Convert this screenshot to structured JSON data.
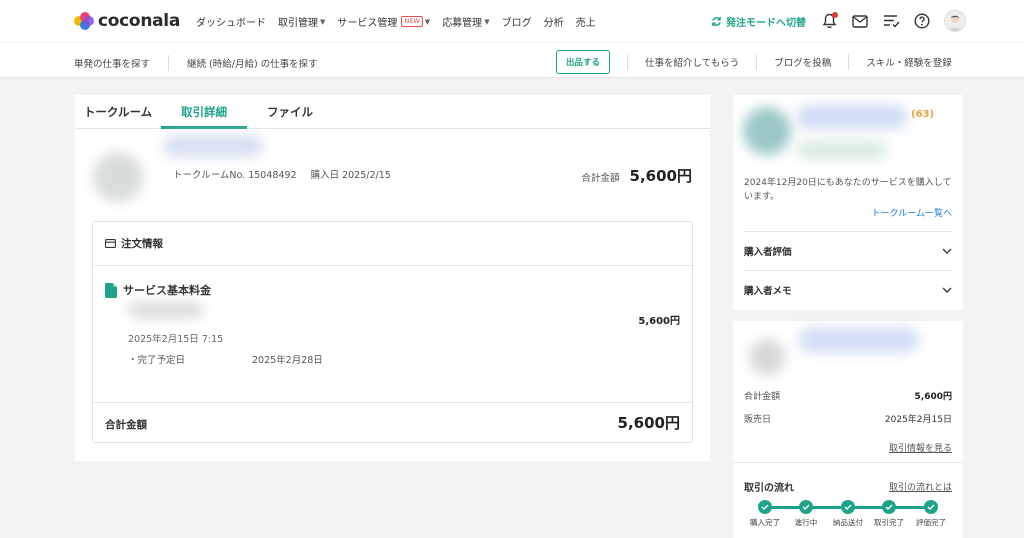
{
  "header": {
    "logo_text": "coconala",
    "nav": [
      {
        "label": "ダッシュボード",
        "chevron": false
      },
      {
        "label": "取引管理",
        "chevron": true
      },
      {
        "label": "サービス管理",
        "badge": "NEW",
        "chevron": true
      },
      {
        "label": "応募管理",
        "chevron": true
      },
      {
        "label": "ブログ",
        "chevron": false
      },
      {
        "label": "分析",
        "chevron": false
      },
      {
        "label": "売上",
        "chevron": false
      }
    ],
    "mode_switch": "発注モードへ切替",
    "icons": [
      "bell-icon",
      "mail-icon",
      "checklist-icon",
      "help-icon",
      "avatar"
    ],
    "accent_color": "#1ea38a",
    "notification_color": "#e0393e"
  },
  "subnav": {
    "left": [
      "単発の仕事を探す",
      "継続 (時給/月給) の仕事を探す"
    ],
    "publish_button": "出品する",
    "right": [
      "仕事を紹介してもらう",
      "ブログを投稿",
      "スキル・経験を登録"
    ]
  },
  "tabs": [
    {
      "label": "トークルーム",
      "active": false
    },
    {
      "label": "取引詳細",
      "active": true
    },
    {
      "label": "ファイル",
      "active": false
    }
  ],
  "room": {
    "room_no": "トークルームNo. 15048492",
    "purchase_date": "購入日 2025/2/15",
    "total_label": "合計金額",
    "total_value": "5,600円"
  },
  "order": {
    "heading": "注文情報",
    "service_title": "サービス基本料金",
    "service_price": "5,600円",
    "ordered_at": "2025年2月15日 7:15",
    "due_label": "・完了予定日",
    "due_value": "2025年2月28日",
    "total_label": "合計金額",
    "total_value": "5,600円"
  },
  "buyer": {
    "rating_count": "(63)",
    "message": "2024年12月20日にもあなたのサービスを購入しています。",
    "rooms_link": "トークルーム一覧へ",
    "accordions": [
      "購入者評価",
      "購入者メモ"
    ]
  },
  "service_summary": {
    "rows": [
      {
        "k": "合計金額",
        "v": "5,600円"
      },
      {
        "k": "販売日",
        "v": "2025年2月15日"
      }
    ],
    "info_link": "取引情報を見る"
  },
  "flow": {
    "title": "取引の流れ",
    "link": "取引の流れとは",
    "steps": [
      "購入完了",
      "進行中",
      "納品送付",
      "取引完了",
      "評価完了"
    ]
  }
}
